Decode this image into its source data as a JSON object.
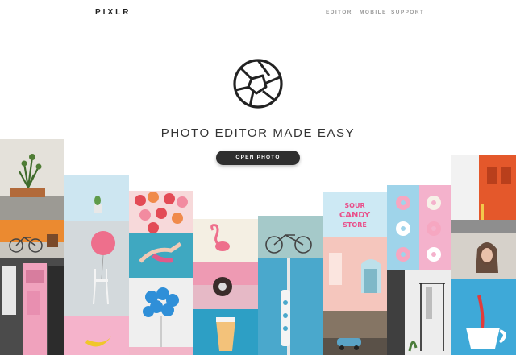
{
  "header": {
    "logo": "PIXLR",
    "nav": [
      {
        "label": "EDITOR"
      },
      {
        "label": "MOBILE"
      },
      {
        "label": "SUPPORT"
      }
    ]
  },
  "hero": {
    "tagline": "PHOTO EDITOR MADE EASY",
    "open_button": "OPEN PHOTO"
  },
  "collage": {
    "tile_colors": {
      "pink": "#f6b6cc",
      "sky": "#cfe9f3",
      "teal": "#4fb0c6",
      "orange": "#e67e2e",
      "peach": "#f6d3c9",
      "yellow": "#f2d33a",
      "gray": "#d7d4cc",
      "dark": "#3b3b3b"
    },
    "candy_sign": "SOUR CANDY STORE"
  }
}
